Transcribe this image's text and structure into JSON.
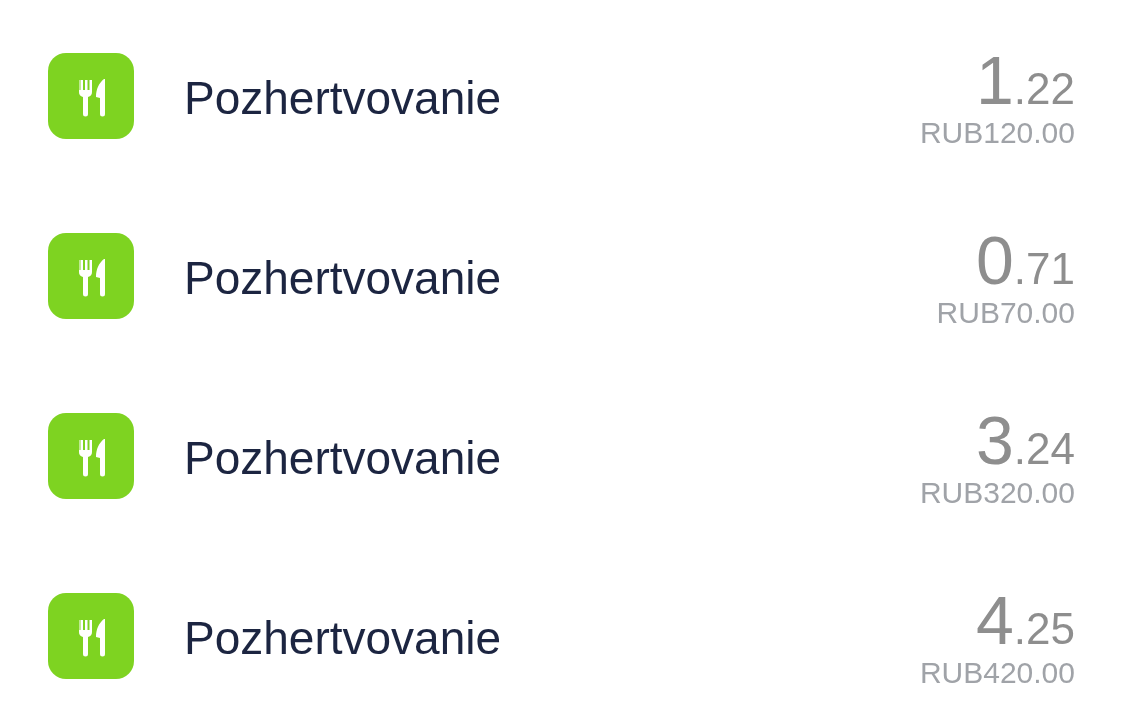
{
  "transactions": [
    {
      "title": "Pozhertvovanie",
      "amount_whole": "1",
      "amount_fraction": ".22",
      "original_amount": "RUB120.00"
    },
    {
      "title": "Pozhertvovanie",
      "amount_whole": "0",
      "amount_fraction": ".71",
      "original_amount": "RUB70.00"
    },
    {
      "title": "Pozhertvovanie",
      "amount_whole": "3",
      "amount_fraction": ".24",
      "original_amount": "RUB320.00"
    },
    {
      "title": "Pozhertvovanie",
      "amount_whole": "4",
      "amount_fraction": ".25",
      "original_amount": "RUB420.00"
    }
  ]
}
